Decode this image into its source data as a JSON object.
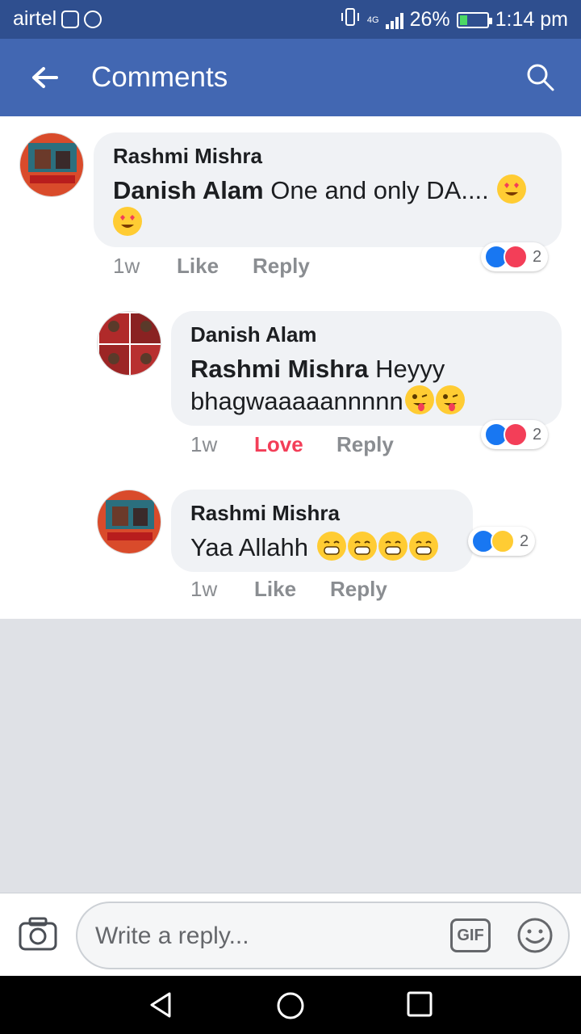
{
  "status_bar": {
    "carrier": "airtel",
    "network": "4G",
    "battery": "26%",
    "battery_level": 0.26,
    "time": "1:14 pm"
  },
  "header": {
    "title": "Comments"
  },
  "comments": [
    {
      "author": "Rashmi Mishra",
      "mention": "Danish Alam",
      "text": " One and only DA.... ",
      "time": "1w",
      "action": "Like",
      "reply": "Reply",
      "reactions": [
        "like",
        "love"
      ],
      "reaction_count": "2"
    },
    {
      "author": "Danish Alam",
      "mention": "Rashmi Mishra",
      "text": " Heyyy",
      "text_line2": "bhagwaaaaannnnn",
      "time": "1w",
      "action": "Love",
      "reply": "Reply",
      "reactions": [
        "like",
        "love"
      ],
      "reaction_count": "2"
    },
    {
      "author": "Rashmi Mishra",
      "text": "Yaa Allahh ",
      "time": "1w",
      "action": "Like",
      "reply": "Reply",
      "reactions": [
        "like",
        "haha"
      ],
      "reaction_count": "2"
    }
  ],
  "input": {
    "placeholder": "Write a reply...",
    "gif_label": "GIF"
  },
  "colors": {
    "header": "#4267b2",
    "status_bar": "#2f4f8f",
    "love": "#f33e58",
    "like": "#1877f2"
  }
}
